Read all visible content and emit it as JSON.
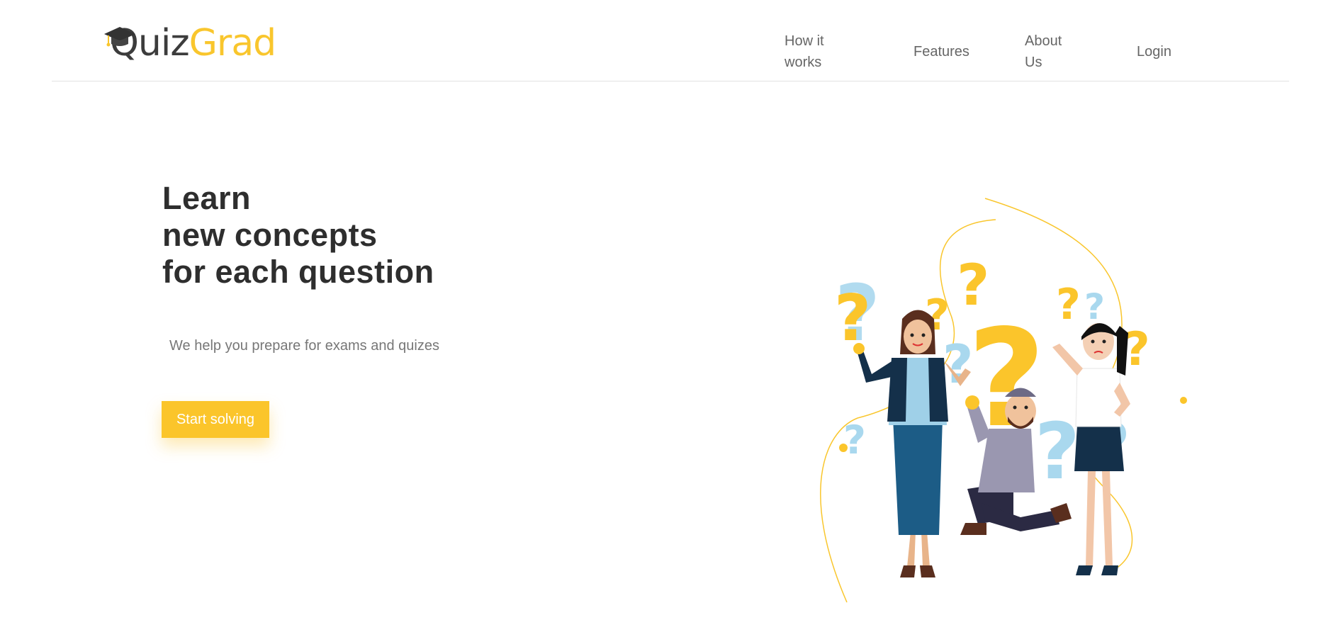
{
  "logo": {
    "part1": "Quiz",
    "part2": "Grad"
  },
  "nav": {
    "how_it_works": "How it works",
    "features": "Features",
    "about_us": "About Us",
    "login": "Login"
  },
  "hero": {
    "title_line1": "Learn",
    "title_line2": "new concepts",
    "title_line3": "for each question",
    "subtitle": "We help you prepare for exams and quizes",
    "cta_label": "Start solving"
  },
  "colors": {
    "accent": "#fbc52b",
    "text_dark": "#2e2e2e",
    "text_muted": "#777777",
    "question_blue": "#a9d8ee"
  }
}
